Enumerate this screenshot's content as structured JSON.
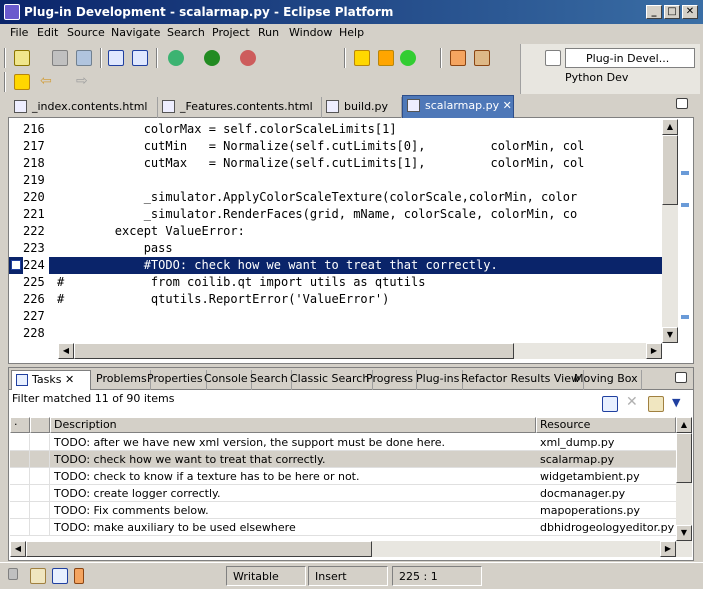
{
  "window": {
    "title": "Plug-in Development - scalarmap.py - Eclipse Platform",
    "min": "_",
    "max": "□",
    "close": "✕"
  },
  "menu": [
    "File",
    "Edit",
    "Source",
    "Navigate",
    "Search",
    "Project",
    "Run",
    "Window",
    "Help"
  ],
  "perspectives": {
    "primary": "Plug-in Devel...",
    "secondary": "Python Dev"
  },
  "editor_tabs": [
    {
      "label": "_index.contents.html"
    },
    {
      "label": "_Features.contents.html"
    },
    {
      "label": "build.py"
    },
    {
      "label": "scalarmap.py",
      "active": true,
      "close": "✕"
    }
  ],
  "code_lines": [
    {
      "num": "216",
      "text": "            colorMax = self.colorScaleLimits[1]"
    },
    {
      "num": "217",
      "text": "            cutMin   = Normalize(self.cutLimits[0],         colorMin, col"
    },
    {
      "num": "218",
      "text": "            cutMax   = Normalize(self.cutLimits[1],         colorMin, col"
    },
    {
      "num": "219",
      "text": ""
    },
    {
      "num": "220",
      "text": "            _simulator.ApplyColorScaleTexture(colorScale,colorMin, color"
    },
    {
      "num": "221",
      "text": "            _simulator.RenderFaces(grid, mName, colorScale, colorMin, co"
    },
    {
      "num": "222",
      "text": "        except ValueError:"
    },
    {
      "num": "223",
      "text": "            pass"
    },
    {
      "num": "224",
      "text": "            #TODO: check how we want to treat that correctly."
    },
    {
      "num": "225",
      "text": "#            from coilib.qt import utils as qtutils"
    },
    {
      "num": "226",
      "text": "#            qtutils.ReportError('ValueError')"
    },
    {
      "num": "227",
      "text": ""
    },
    {
      "num": "228",
      "text": ""
    }
  ],
  "task_tabs": [
    "Tasks",
    "Problems",
    "Properties",
    "Console",
    "Search",
    "Classic Search",
    "Progress",
    "Plug-ins",
    "Refactor Results View",
    "Moving Box"
  ],
  "tasks": {
    "filter_text": "Filter matched 11 of 90 items",
    "col_description": "Description",
    "col_resource": "Resource",
    "rows": [
      {
        "desc": "TODO: after we have new xml version, the support must be done here.",
        "res": "xml_dump.py"
      },
      {
        "desc": "TODO: check how we want to treat that correctly.",
        "res": "scalarmap.py",
        "selected": true
      },
      {
        "desc": "TODO: check to know if a texture has to be here or not.",
        "res": "widgetambient.py"
      },
      {
        "desc": "TODO: create logger correctly.",
        "res": "docmanager.py"
      },
      {
        "desc": "TODO: Fix comments below.",
        "res": "mapoperations.py"
      },
      {
        "desc": "TODO: make auxiliary to be used elsewhere",
        "res": "dbhidrogeologyeditor.py"
      }
    ]
  },
  "status": {
    "mode": "Writable",
    "insert": "Insert",
    "position": "225 : 1"
  }
}
